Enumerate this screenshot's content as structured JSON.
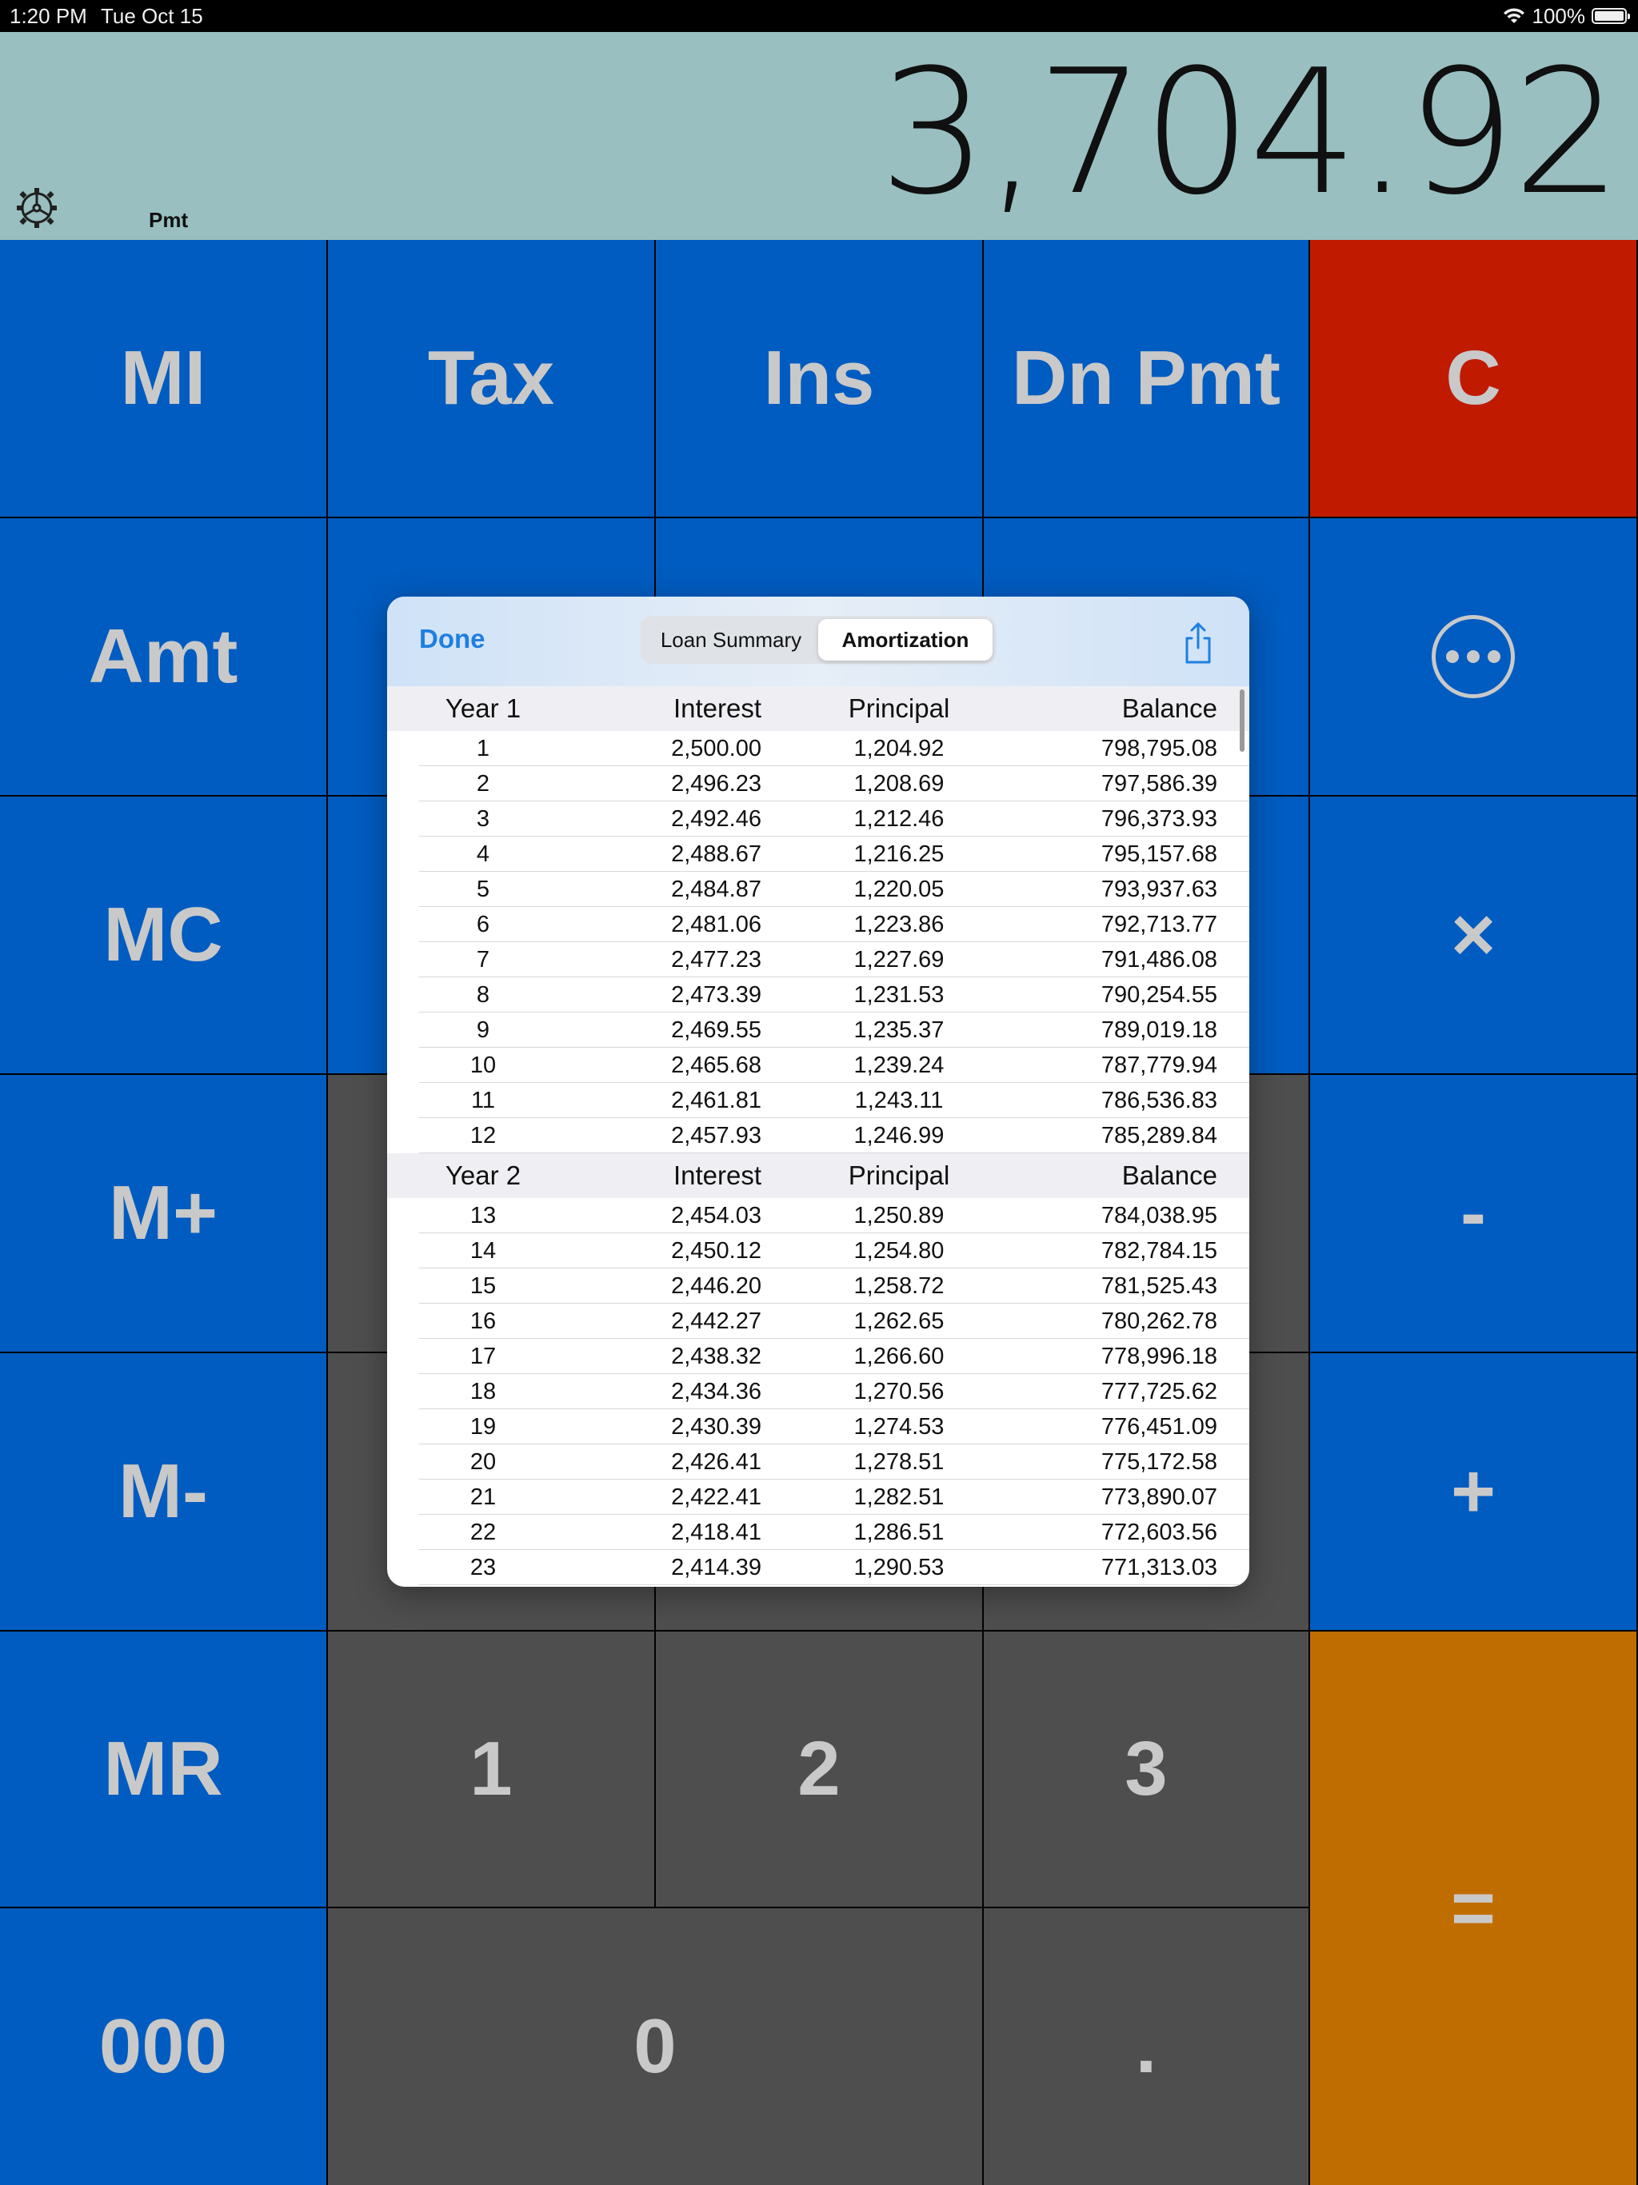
{
  "status": {
    "time": "1:20 PM",
    "date": "Tue Oct 15",
    "battery": "100%",
    "wifi_icon": "wifi-icon",
    "battery_icon": "battery-icon"
  },
  "display": {
    "value": "3,704.92",
    "mode": "Pmt",
    "settings_icon": "gear-icon"
  },
  "keys": {
    "mi": "MI",
    "tax": "Tax",
    "ins": "Ins",
    "dn_pmt": "Dn Pmt",
    "clear": "C",
    "amt": "Amt",
    "more_icon": "more-icon",
    "mc": "MC",
    "multiply": "×",
    "m_plus": "M+",
    "minus": "-",
    "m_minus": "M-",
    "plus": "+",
    "mr": "MR",
    "one": "1",
    "two": "2",
    "three": "3",
    "equals": "=",
    "triple_zero": "000",
    "zero": "0",
    "decimal": "."
  },
  "colors": {
    "display_bg": "#a3cbcc",
    "blue_key": "#0062cc",
    "gray_key": "#535353",
    "clear_key": "#cc1d00",
    "equals_key": "#cc7400",
    "key_text": "#d6d6d6",
    "link_blue": "#1f7fe0"
  },
  "modal": {
    "done_label": "Done",
    "tabs": [
      "Loan Summary",
      "Amortization"
    ],
    "active_tab": "Amortization",
    "share_icon": "share-icon",
    "columns": [
      "Interest",
      "Principal",
      "Balance"
    ],
    "years": [
      {
        "label": "Year 1",
        "rows": [
          [
            "1",
            "2,500.00",
            "1,204.92",
            "798,795.08"
          ],
          [
            "2",
            "2,496.23",
            "1,208.69",
            "797,586.39"
          ],
          [
            "3",
            "2,492.46",
            "1,212.46",
            "796,373.93"
          ],
          [
            "4",
            "2,488.67",
            "1,216.25",
            "795,157.68"
          ],
          [
            "5",
            "2,484.87",
            "1,220.05",
            "793,937.63"
          ],
          [
            "6",
            "2,481.06",
            "1,223.86",
            "792,713.77"
          ],
          [
            "7",
            "2,477.23",
            "1,227.69",
            "791,486.08"
          ],
          [
            "8",
            "2,473.39",
            "1,231.53",
            "790,254.55"
          ],
          [
            "9",
            "2,469.55",
            "1,235.37",
            "789,019.18"
          ],
          [
            "10",
            "2,465.68",
            "1,239.24",
            "787,779.94"
          ],
          [
            "11",
            "2,461.81",
            "1,243.11",
            "786,536.83"
          ],
          [
            "12",
            "2,457.93",
            "1,246.99",
            "785,289.84"
          ]
        ]
      },
      {
        "label": "Year 2",
        "rows": [
          [
            "13",
            "2,454.03",
            "1,250.89",
            "784,038.95"
          ],
          [
            "14",
            "2,450.12",
            "1,254.80",
            "782,784.15"
          ],
          [
            "15",
            "2,446.20",
            "1,258.72",
            "781,525.43"
          ],
          [
            "16",
            "2,442.27",
            "1,262.65",
            "780,262.78"
          ],
          [
            "17",
            "2,438.32",
            "1,266.60",
            "778,996.18"
          ],
          [
            "18",
            "2,434.36",
            "1,270.56",
            "777,725.62"
          ],
          [
            "19",
            "2,430.39",
            "1,274.53",
            "776,451.09"
          ],
          [
            "20",
            "2,426.41",
            "1,278.51",
            "775,172.58"
          ],
          [
            "21",
            "2,422.41",
            "1,282.51",
            "773,890.07"
          ],
          [
            "22",
            "2,418.41",
            "1,286.51",
            "772,603.56"
          ],
          [
            "23",
            "2,414.39",
            "1,290.53",
            "771,313.03"
          ]
        ]
      }
    ]
  }
}
